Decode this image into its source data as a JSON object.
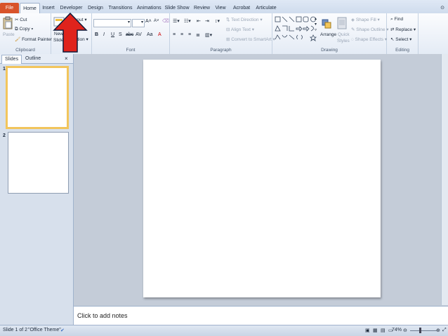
{
  "tabs": [
    "File",
    "Home",
    "Insert",
    "Developer",
    "Design",
    "Transitions",
    "Animations",
    "Slide Show",
    "Review",
    "View",
    "Acrobat",
    "Articulate"
  ],
  "clipboard": {
    "paste": "Paste",
    "cut": "Cut",
    "copy": "Copy",
    "format_painter": "Format Painter",
    "label": "Clipboard"
  },
  "slides_group": {
    "new_slide": "New",
    "new_slide_2": "Slide",
    "layout": "Layout",
    "section": "Section"
  },
  "font": {
    "label": "Font",
    "bold": "B",
    "italic": "I",
    "underline": "U",
    "strike": "S",
    "shadow": "abc",
    "spacing": "AV",
    "case": "Aa",
    "grow": "A",
    "shrink": "A"
  },
  "paragraph": {
    "label": "Paragraph",
    "text_direction": "Text Direction",
    "align_text": "Align Text",
    "smartart": "Convert to SmartArt"
  },
  "drawing": {
    "label": "Drawing",
    "arrange": "Arrange",
    "quick_styles": "Quick",
    "quick_styles_2": "Styles",
    "shape_fill": "Shape Fill",
    "shape_outline": "Shape Outline",
    "shape_effects": "Shape Effects"
  },
  "editing": {
    "label": "Editing",
    "find": "Find",
    "replace": "Replace",
    "select": "Select"
  },
  "pane": {
    "slides_tab": "Slides",
    "outline_tab": "Outline",
    "close": "×",
    "slide_numbers": [
      "1",
      "2"
    ]
  },
  "notes": {
    "placeholder": "Click to add notes"
  },
  "status": {
    "slide_info": "Slide 1 of 2",
    "theme": "\"Office Theme\"",
    "zoom": "74%"
  },
  "colors": {
    "file_tab": "#d8532a",
    "selection": "#f2c55c",
    "arrow": "#e0231c"
  }
}
